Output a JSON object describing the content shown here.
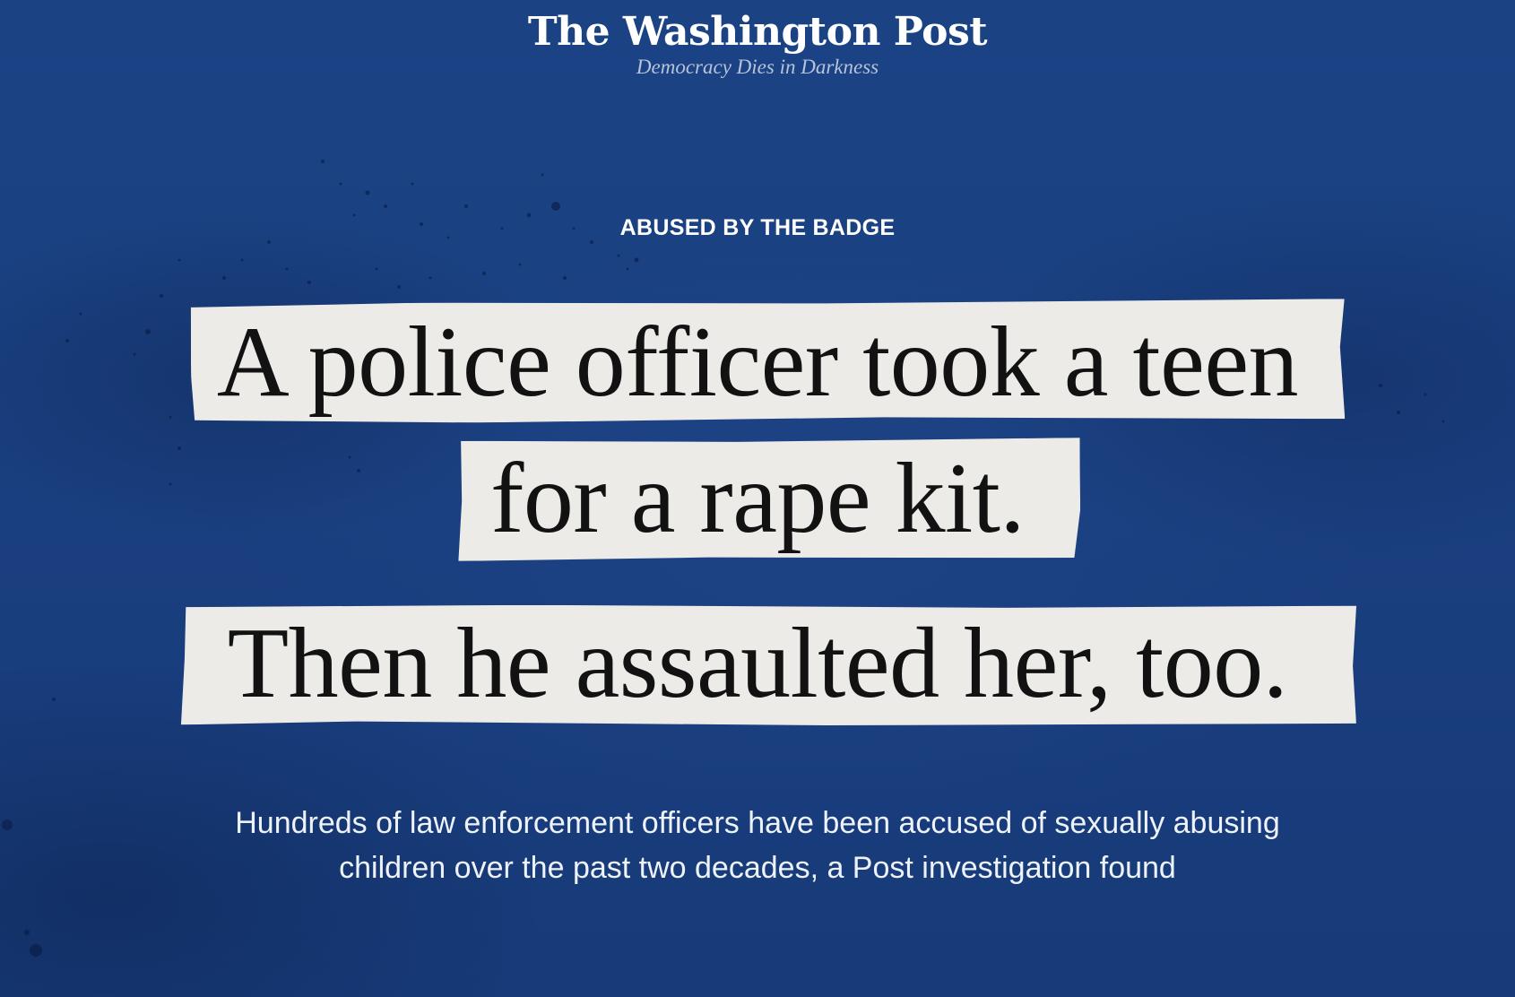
{
  "masthead": {
    "logo": "The Washington Post",
    "tagline": "Democracy Dies in Darkness"
  },
  "article": {
    "kicker": "ABUSED BY THE BADGE",
    "headline_lines": [
      "A police officer took a teen",
      "for a rape kit.",
      "Then he assaulted her, too."
    ],
    "dek": "Hundreds of law enforcement officers have been accused of sexually abusing children over the past two decades, a Post investigation found"
  },
  "colors": {
    "background": "#1a3f82",
    "paper_strip": "#ecebe7",
    "headline_text": "#121212",
    "body_text": "#eef2f9"
  }
}
